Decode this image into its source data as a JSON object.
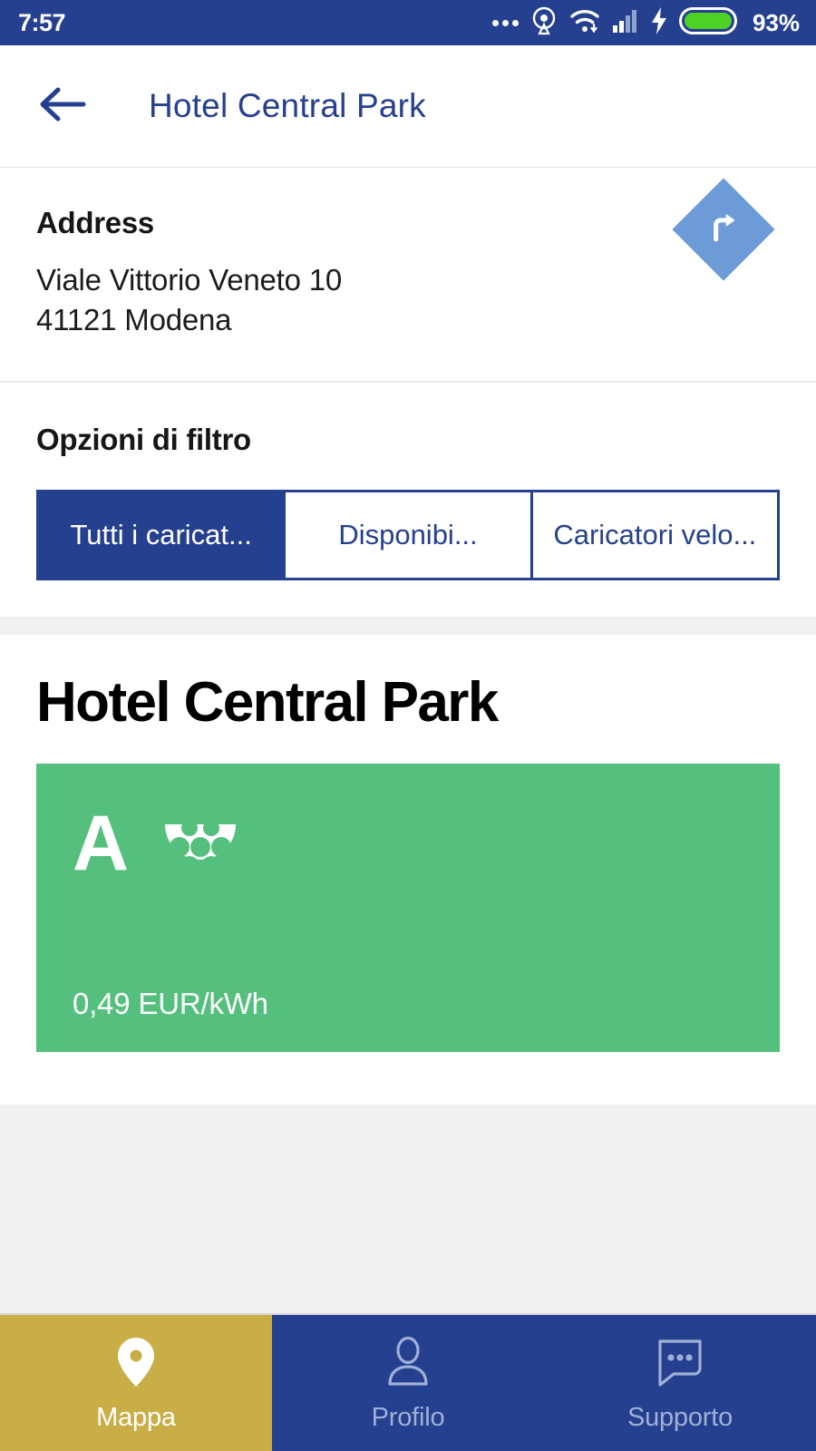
{
  "status_bar": {
    "time": "7:57",
    "battery_percent": "93%",
    "icons": [
      "more-dots-icon",
      "location-beacon-icon",
      "wifi-icon",
      "signal-icon",
      "charging-bolt-icon",
      "battery-icon"
    ],
    "background_color": "#25408f"
  },
  "appbar": {
    "back_icon": "arrow-left-icon",
    "title": "Hotel Central Park",
    "title_color": "#25408f"
  },
  "address_card": {
    "heading": "Address",
    "line1": "Viale Vittorio Veneto 10",
    "line2": "41121 Modena",
    "navigate_icon": "turn-right-icon",
    "navigate_color": "#6d9bd8"
  },
  "filter_card": {
    "heading": "Opzioni di filtro",
    "segments": [
      {
        "label": "Tutti i caricat...",
        "active": true
      },
      {
        "label": "Disponibi...",
        "active": false
      },
      {
        "label": "Caricatori velo...",
        "active": false
      }
    ],
    "accent_color": "#25408f"
  },
  "charger_card": {
    "title": "Hotel Central Park",
    "connector": {
      "letter": "A",
      "connector_icon": "type2-connector-icon",
      "price": "0,49 EUR/kWh",
      "status_color": "#55c07e"
    }
  },
  "bottom_nav": {
    "items": [
      {
        "label": "Mappa",
        "icon": "map-pin-icon",
        "active": true
      },
      {
        "label": "Profilo",
        "icon": "person-icon",
        "active": false
      },
      {
        "label": "Supporto",
        "icon": "chat-bubble-icon",
        "active": false
      }
    ],
    "active_color": "#c9ae47",
    "inactive_color": "#25408f"
  }
}
